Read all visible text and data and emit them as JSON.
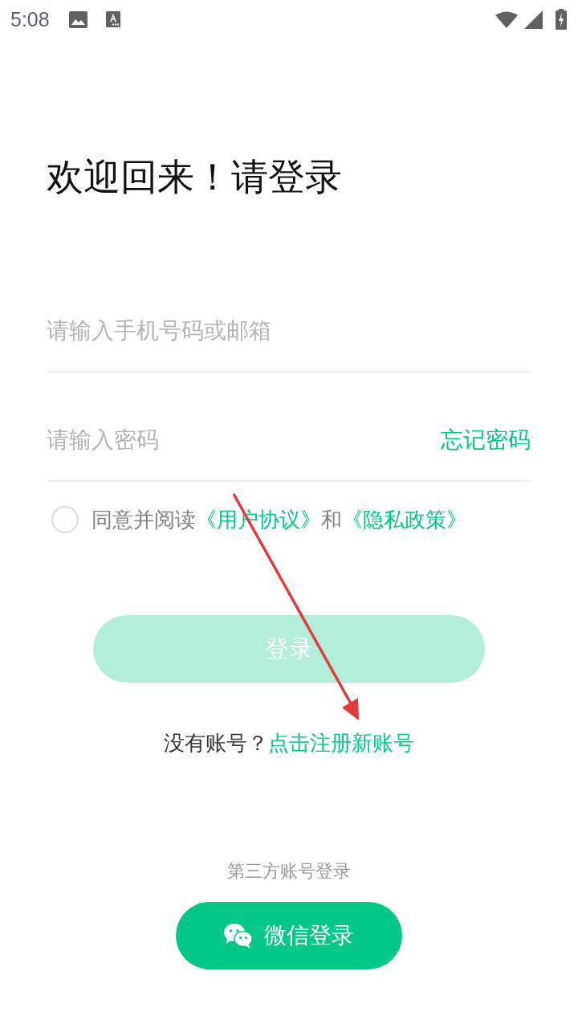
{
  "status_bar": {
    "time": "5:08"
  },
  "title": "欢迎回来！请登录",
  "fields": [
    {
      "placeholder": "请输入手机号码或邮箱"
    },
    {
      "placeholder": "请输入密码",
      "link": "忘记密码"
    }
  ],
  "agreement": {
    "checked": false,
    "parts": [
      {
        "kind": "plain",
        "text": "同意并阅读"
      },
      {
        "kind": "link",
        "text": "《用户协议》"
      },
      {
        "kind": "plain",
        "text": "和"
      },
      {
        "kind": "link",
        "text": "《隐私政策》"
      }
    ]
  },
  "login_button": {
    "label": "登录",
    "disabled": true
  },
  "register": {
    "prompt": "没有账号？",
    "link": "点击注册新账号"
  },
  "third_party": {
    "heading": "第三方账号登录",
    "buttons": [
      {
        "kind": "wechat",
        "label": "微信登录"
      }
    ]
  },
  "annotations": [
    {
      "kind": "arrow"
    }
  ]
}
